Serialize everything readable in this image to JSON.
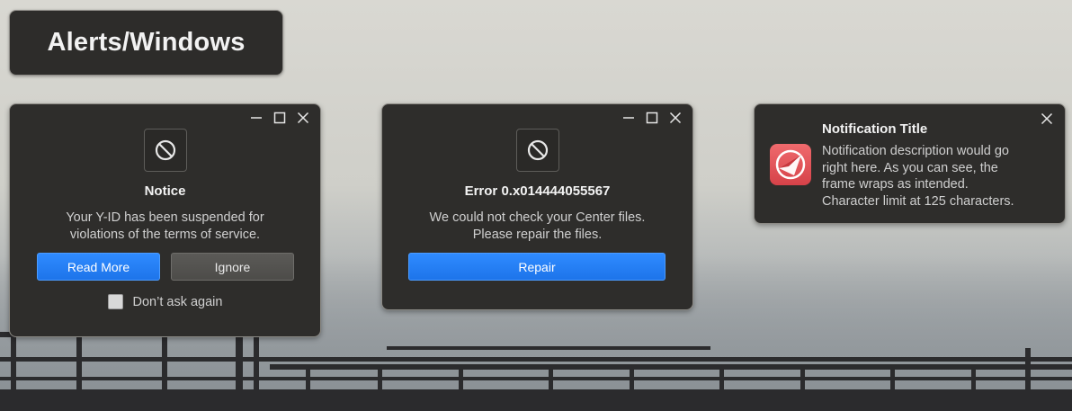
{
  "page": {
    "heading": "Alerts/Windows"
  },
  "colors": {
    "primary_button": "#1d74ea",
    "window_bg": "#2e2d2b",
    "app_icon": "#d64249"
  },
  "notice_dialog": {
    "icon": "ban-icon",
    "title": "Notice",
    "message_line1": "Your Y-ID has been suspended for",
    "message_line2": "violations of the terms of service.",
    "primary_label": "Read More",
    "secondary_label": "Ignore",
    "checkbox_label": "Don’t ask again",
    "checkbox_checked": false
  },
  "error_dialog": {
    "icon": "ban-icon",
    "title": "Error 0.x014444055567",
    "message_line1": "We could not check your Center files.",
    "message_line2": "Please repair the files.",
    "primary_label": "Repair"
  },
  "notification": {
    "icon": "app-logo-icon",
    "title": "Notification Title",
    "line1": "Notification description would go",
    "line2": "right here. As you can see, the",
    "line3": "frame wraps as intended.",
    "line4": "Character limit at 125 characters."
  }
}
